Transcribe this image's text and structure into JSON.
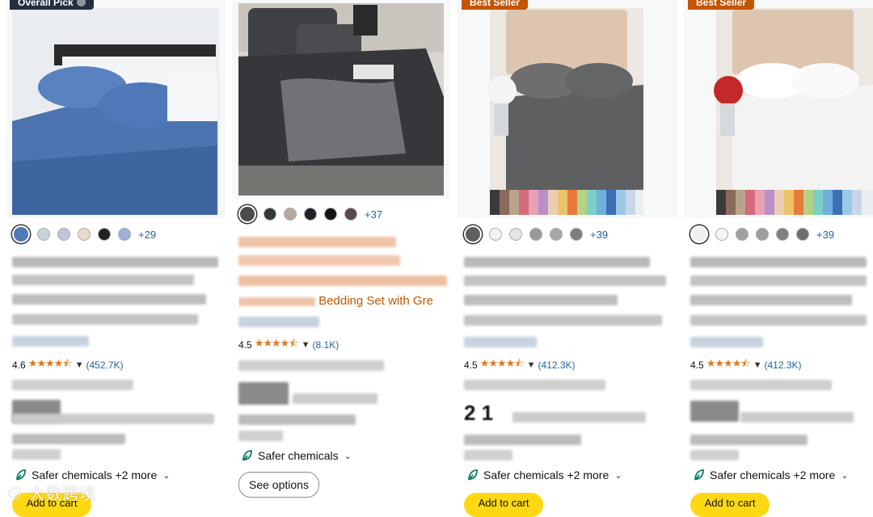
{
  "products": [
    {
      "badge": "Overall Pick",
      "swatches": [
        "#5278b8",
        "#c7d5da",
        "#bfc4d6",
        "#e8dcc8",
        "#222222",
        "#a1aed6"
      ],
      "more_colors": "+29",
      "rating": "4.6",
      "stars": "★★★★⯪",
      "reviews": "(452.7K)",
      "safer": "Safer chemicals +2 more",
      "cta": "Add to cart"
    },
    {
      "swatches": [
        "#4a4c4e",
        "#2f3a34",
        "#b6a89a",
        "#1f2124",
        "#141414",
        "#5a4a44"
      ],
      "more_colors": "+37",
      "title_tail": "Bedding Set with Grey...",
      "rating": "4.5",
      "stars": "★★★★⯪",
      "reviews": "(8.1K)",
      "safer": "Safer chemicals",
      "cta": "See options"
    },
    {
      "badge": "Best Seller",
      "swatches": [
        "#5f5f5f",
        "#f2f2f2",
        "#e3e3e3",
        "#9a9a9a",
        "#a8a8a8",
        "#7e7e7e"
      ],
      "more_colors": "+39",
      "rating": "4.5",
      "stars": "★★★★⯪",
      "reviews": "(412.3K)",
      "price_fragment": "2 1",
      "safer": "Safer chemicals +2 more",
      "cta": "Add to cart"
    },
    {
      "badge": "Best Seller",
      "swatches": [
        "#f0f0f0",
        "#f5f5f5",
        "#a0a0a0",
        "#9e9e9e",
        "#808080",
        "#6e6e6e"
      ],
      "more_colors": "+39",
      "rating": "4.5",
      "stars": "★★★★⯪",
      "reviews": "(412.3K)",
      "safer": "Safer chemicals +2 more",
      "cta": "Add to cart"
    }
  ],
  "watermark": "大数跨境"
}
